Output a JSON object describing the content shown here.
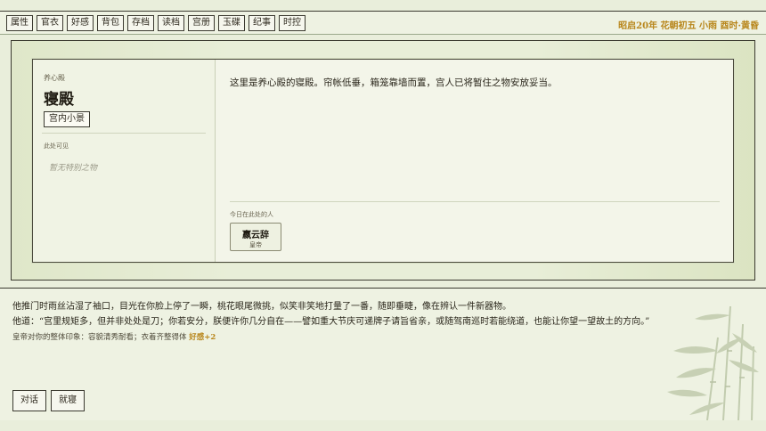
{
  "menu": [
    "属性",
    "官衣",
    "好感",
    "背包",
    "存档",
    "读档",
    "宫册",
    "玉碟",
    "纪事",
    "时控"
  ],
  "datetime": "昭启20年 花朝初五 小雨 酉时·黄昏",
  "location": {
    "parent": "养心殿",
    "name": "寝殿",
    "scene_button": "宫内小景",
    "visible_label": "此处可见",
    "visible_empty": "暂无特别之物",
    "description": "这里是养心殿的寝殿。帘帐低垂，箱笼靠墙而置，宫人已将暂住之物安放妥当。",
    "people_label": "今日在此处的人",
    "people": [
      {
        "name": "嬴云辞",
        "title": "皇帝"
      }
    ]
  },
  "dialogue": {
    "line1": "他推门时雨丝沾湿了袖口，目光在你脸上停了一瞬，桃花眼尾微挑，似笑非笑地打量了一番，随即垂睫，像在辨认一件新器物。",
    "line2": "他道：“宫里规矩多，但并非处处是刀；你若安分，朕便许你几分自在——譬如重大节庆可递牌子请旨省亲，或随驾南巡时若能绕道，也能让你望一望故土的方向。”",
    "impression_text": "皇帝对你的整体印象：容貌清秀耐看；衣着齐整得体",
    "impression_favor": "好感+2"
  },
  "actions": [
    "对话",
    "就寝"
  ],
  "colors": {
    "accent": "#b8861b",
    "background": "#e9eedb",
    "border": "#3b3a30"
  }
}
